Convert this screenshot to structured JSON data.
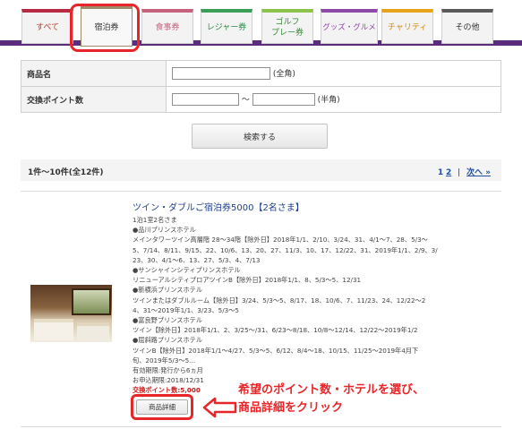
{
  "tabs": [
    {
      "label": "すべて",
      "color": "#b82a43",
      "text_color": "#c0392b"
    },
    {
      "label": "宿泊券",
      "color": "#9c8a69",
      "text_color": "#333333"
    },
    {
      "label": "食事券",
      "color": "#c8617e",
      "text_color": "#c8617e"
    },
    {
      "label": "レジャー券",
      "color": "#3b9e57",
      "text_color": "#2d8a4a"
    },
    {
      "label_line1": "ゴルフ",
      "label_line2": "プレー券",
      "color": "#8bc34a",
      "text_color": "#3b8a3b"
    },
    {
      "label": "グッズ・グルメ",
      "color": "#8e4aa7",
      "text_color": "#8e4aa7"
    },
    {
      "label": "チャリティ",
      "color": "#e8a21c",
      "text_color": "#d08a10"
    },
    {
      "label": "その他",
      "color": "#5a5a5a",
      "text_color": "#333333"
    }
  ],
  "search": {
    "name_label": "商品名",
    "name_hint": "(全角)",
    "points_label": "交換ポイント数",
    "range_sep": "〜",
    "points_hint": "(半角)",
    "button": "検索する"
  },
  "results": {
    "count": "1件〜10件(全12件)",
    "page_current": "1",
    "page_2": "2",
    "separator": "|",
    "next": "次へ »"
  },
  "item": {
    "title": "ツイン・ダブルご宿泊券5000【2名さま】",
    "lines": [
      "1泊1室2名さま",
      "●品川プリンスホテル",
      "メインタワーツイン高層階 28〜34階【除外日】2018年1/1、2/10、3/24、31、4/1〜7、28、5/3〜",
      "5、7/14、8/11、9/15、22、10/6、13、20、27、11/3、10、17、12/22、31、2019年1/1、2/9、3/",
      "23、30、4/1〜6、13、27、5/3、4、7/13",
      "●サンシャインシティプリンスホテル",
      "リニューアルシティプロアツインB【除外日】2018年1/1、8、5/3〜5、12/31",
      "●新横浜プリンスホテル",
      "ツインまたはダブルルーム【除外日】3/24、5/3〜5、8/17、18、10/6、7、11/23、24、12/22〜2",
      "4、31〜2019年1/1、3/23、5/3〜5",
      "●富良野プリンスホテル",
      "ツイン【除外日】2018年1/1、2、3/25〜/31、6/23〜8/18、10/8〜12/14、12/22〜2019年1/2",
      "●屈斜路プリンスホテル",
      "ツインB【除外日】2018年1/1〜4/27、5/3〜5、6/12、8/4〜18、10/15、11/25〜2019年4月下",
      "旬、2019年5/3〜5...",
      "有効期限:発行から6ヵ月",
      "お申込期限:2018/12/31"
    ],
    "points": "交換ポイント数:5,000",
    "detail_button": "商品詳細"
  },
  "annotation": {
    "line1": "希望のポイント数・ホテルを選び、",
    "line2": "商品詳細をクリック"
  }
}
